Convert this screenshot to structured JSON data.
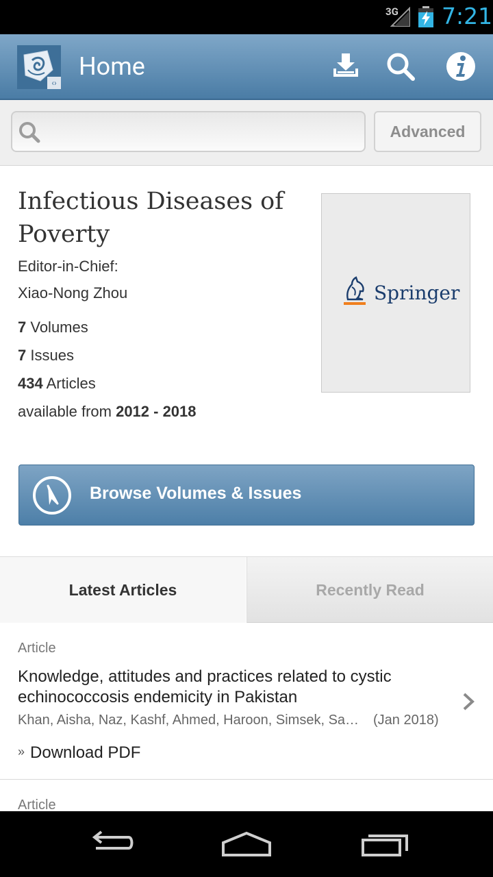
{
  "status_bar": {
    "network": "3G",
    "time": "7:21"
  },
  "action_bar": {
    "title": "Home"
  },
  "search": {
    "placeholder": "",
    "advanced_label": "Advanced"
  },
  "journal": {
    "title": "Infectious Diseases of Poverty",
    "editor_label": "Editor-in-Chief:",
    "editor_name": "Xiao-Nong Zhou",
    "volumes_count": "7",
    "volumes_label": " Volumes",
    "issues_count": "7",
    "issues_label": " Issues",
    "articles_count": "434",
    "articles_label": " Articles",
    "available_prefix": "available from ",
    "available_range": "2012 - 2018",
    "publisher": "Springer"
  },
  "browse_button": {
    "label": "Browse Volumes & Issues"
  },
  "tabs": [
    {
      "label": "Latest Articles",
      "selected": true
    },
    {
      "label": "Recently Read",
      "selected": false
    }
  ],
  "articles": [
    {
      "type": "Article",
      "title": "Knowledge, attitudes and practices related to cystic echinococcosis endemicity in Pakistan",
      "authors": "Khan, Aisha, Naz, Kashf, Ahmed, Haroon, Simsek, Sami, Afzal, Muhammad Sohail",
      "date": "(Jan 2018)",
      "download_label": "Download PDF"
    },
    {
      "type": "Article"
    }
  ],
  "colors": {
    "accent": "#33b5e5",
    "action_bar": "#5d8db5",
    "springer_blue": "#1b3d6d",
    "springer_orange": "#f07f1e"
  }
}
